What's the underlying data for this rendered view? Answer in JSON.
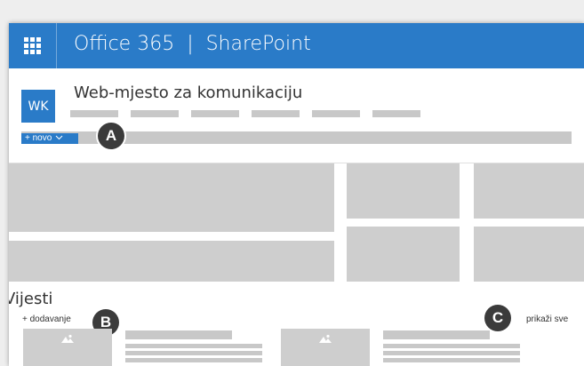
{
  "suite_bar": {
    "app_launcher_icon": "waffle-icon",
    "title": "Office 365  |  SharePoint",
    "background_color": "#2a7bc8"
  },
  "site_header": {
    "logo_initials": "WK",
    "title": "Web-mjesto za komunikaciju"
  },
  "command_bar": {
    "new_button_label": "+ novo",
    "new_button_icon": "chevron-down-icon"
  },
  "callouts": {
    "a": "A",
    "b": "B",
    "c": "C"
  },
  "news": {
    "heading": "Vijesti",
    "add_label": "+ dodavanje",
    "see_all_label": "prikaži sve",
    "thumbnail_icon": "image-icon"
  },
  "colors": {
    "accent": "#2a7bc8",
    "placeholder": "#cecece",
    "callout": "#3b3b3b"
  }
}
